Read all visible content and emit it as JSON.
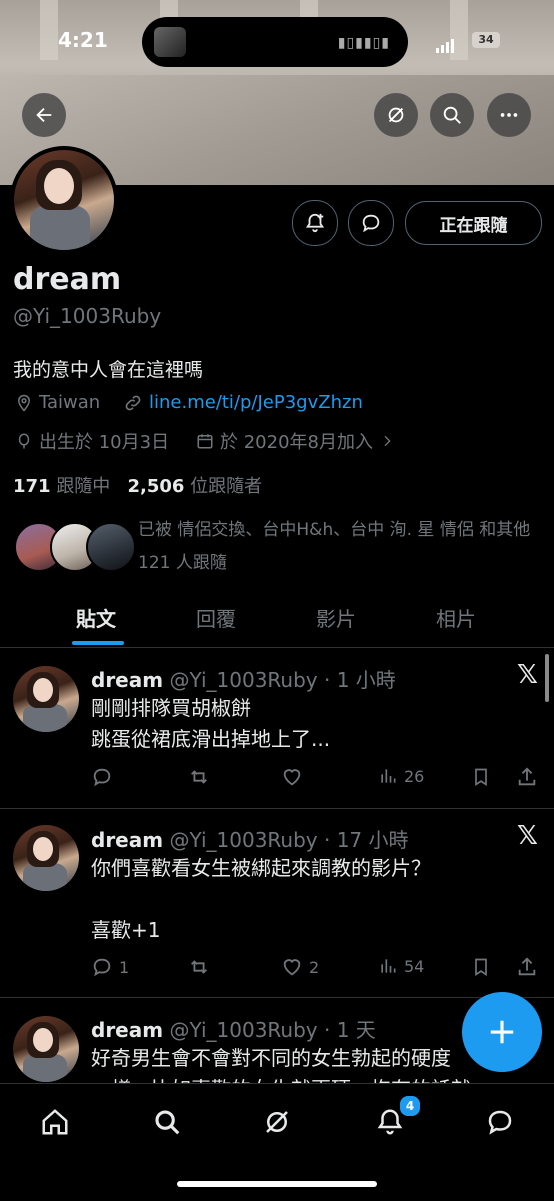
{
  "status_bar": {
    "time": "4:21",
    "battery": "34"
  },
  "header": {
    "back_icon": "arrow-left-icon",
    "grok_icon": "grok-icon",
    "search_icon": "search-icon",
    "more_icon": "more-icon"
  },
  "profile": {
    "name": "dream",
    "handle": "@Yi_1003Ruby",
    "bio": "我的意中人會在這裡嗎",
    "location": "Taiwan",
    "link": "line.me/ti/p/JeP3gvZhzn",
    "birthday": "出生於 10月3日",
    "joined": "於 2020年8月加入",
    "following_count": "171",
    "following_label": "跟隨中",
    "followers_count": "2,506",
    "followers_label": "位跟隨者",
    "follow_button": "正在跟隨",
    "followed_by": "已被 情侶交換、台中H&h、台中 洵. 星 情侶 和其他 121 人跟隨"
  },
  "tabs": [
    {
      "label": "貼文",
      "active": true
    },
    {
      "label": "回覆",
      "active": false
    },
    {
      "label": "影片",
      "active": false
    },
    {
      "label": "相片",
      "active": false
    }
  ],
  "posts": [
    {
      "name": "dream",
      "meta": "@Yi_1003Ruby · 1 小時",
      "text": "剛剛排隊買胡椒餅\n跳蛋從裙底滑出掉地上了...",
      "replies": "",
      "reposts": "",
      "likes": "",
      "views": "26"
    },
    {
      "name": "dream",
      "meta": "@Yi_1003Ruby · 17 小時",
      "text": "你們喜歡看女生被綁起來調教的影片？\n\n喜歡+1",
      "replies": "1",
      "reposts": "",
      "likes": "2",
      "views": "54"
    },
    {
      "name": "dream",
      "meta": "@Yi_1003Ruby · 1 天",
      "text": "好奇男生會不會對不同的女生勃起的硬度\n一樣，比如喜歡的女生就更硬，抱有的話就",
      "replies": "",
      "reposts": "",
      "likes": "",
      "views": ""
    }
  ],
  "fab": {
    "icon": "plus-icon"
  },
  "bottom_nav": {
    "notifications_badge": "4"
  },
  "colors": {
    "accent": "#1d9bf0",
    "background": "#000000",
    "muted": "#71767b",
    "text": "#e7e9ea"
  }
}
